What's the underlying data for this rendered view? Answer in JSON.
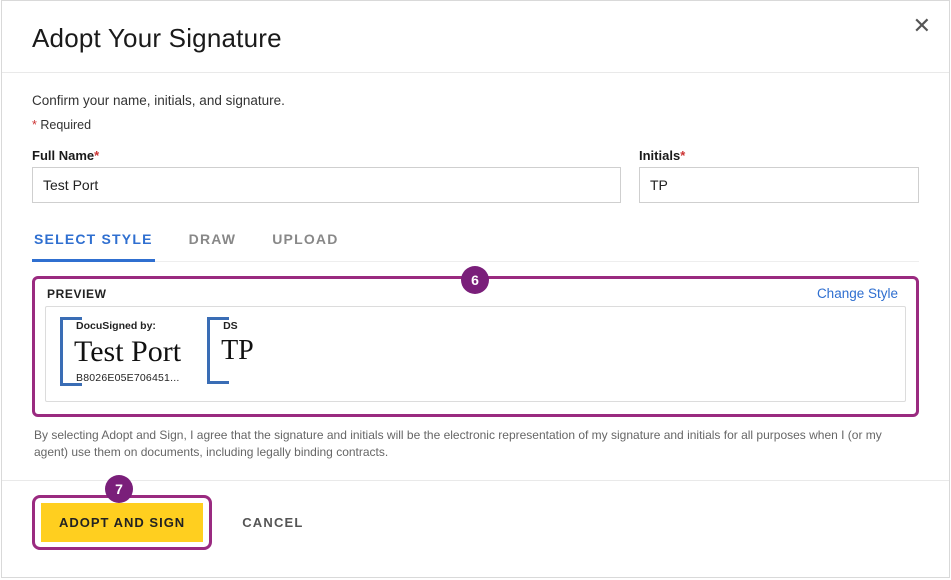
{
  "modal": {
    "title": "Adopt Your Signature",
    "instruction": "Confirm your name, initials, and signature.",
    "required_note_prefix": "*",
    "required_note_text": " Required",
    "fields": {
      "full_name": {
        "label": "Full Name",
        "value": "Test Port"
      },
      "initials": {
        "label": "Initials",
        "value": "TP"
      }
    },
    "tabs": {
      "select_style": "SELECT STYLE",
      "draw": "DRAW",
      "upload": "UPLOAD"
    },
    "preview": {
      "label": "PREVIEW",
      "change_style": "Change Style",
      "signature": {
        "tag": "DocuSigned by:",
        "script": "Test Port",
        "hash": "B8026E05E706451..."
      },
      "initials_block": {
        "tag": "DS",
        "script": "TP"
      }
    },
    "disclaimer": "By selecting Adopt and Sign, I agree that the signature and initials will be the electronic representation of my signature and initials for all purposes when I (or my agent) use them on documents, including legally binding contracts.",
    "buttons": {
      "adopt": "ADOPT AND SIGN",
      "cancel": "CANCEL"
    }
  },
  "callouts": {
    "six": "6",
    "seven": "7"
  }
}
